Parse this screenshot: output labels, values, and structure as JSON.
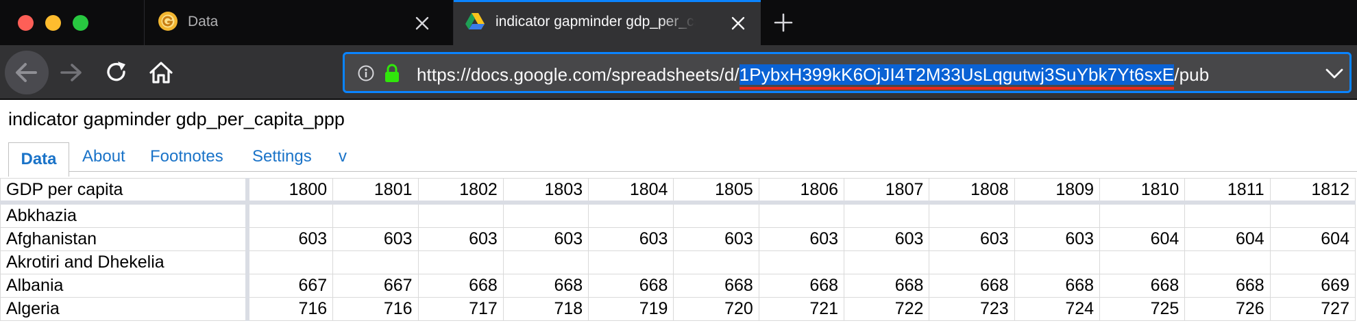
{
  "browser": {
    "tabs": [
      {
        "title": "Data",
        "active": false
      },
      {
        "title": "indicator gapminder gdp_per_capita_ppp",
        "active": true
      }
    ],
    "url": {
      "prefix": "https://docs.google.com/spreadsheets/d/",
      "highlight": "1PybxH399kK6OjJI4T2M33UsLqgutwj3SuYbk7Yt6sxE",
      "suffix": "/pub"
    },
    "accent_color": "#0a84ff",
    "highlight_underline_color": "#e8281a"
  },
  "sheet": {
    "title": "indicator gapminder gdp_per_capita_ppp",
    "tabs": [
      "Data",
      "About",
      "Footnotes",
      "Settings",
      "v"
    ],
    "active_tab": "Data",
    "columns": [
      "GDP per capita",
      "1800",
      "1801",
      "1802",
      "1803",
      "1804",
      "1805",
      "1806",
      "1807",
      "1808",
      "1809",
      "1810",
      "1811",
      "1812"
    ],
    "rows": [
      {
        "country": "Abkhazia",
        "values": [
          "",
          "",
          "",
          "",
          "",
          "",
          "",
          "",
          "",
          "",
          "",
          "",
          ""
        ]
      },
      {
        "country": "Afghanistan",
        "values": [
          "603",
          "603",
          "603",
          "603",
          "603",
          "603",
          "603",
          "603",
          "603",
          "603",
          "604",
          "604",
          "604"
        ]
      },
      {
        "country": "Akrotiri and Dhekelia",
        "values": [
          "",
          "",
          "",
          "",
          "",
          "",
          "",
          "",
          "",
          "",
          "",
          "",
          ""
        ]
      },
      {
        "country": "Albania",
        "values": [
          "667",
          "667",
          "668",
          "668",
          "668",
          "668",
          "668",
          "668",
          "668",
          "668",
          "668",
          "668",
          "669"
        ]
      },
      {
        "country": "Algeria",
        "values": [
          "716",
          "716",
          "717",
          "718",
          "719",
          "720",
          "721",
          "722",
          "723",
          "724",
          "725",
          "726",
          "727"
        ]
      }
    ]
  }
}
